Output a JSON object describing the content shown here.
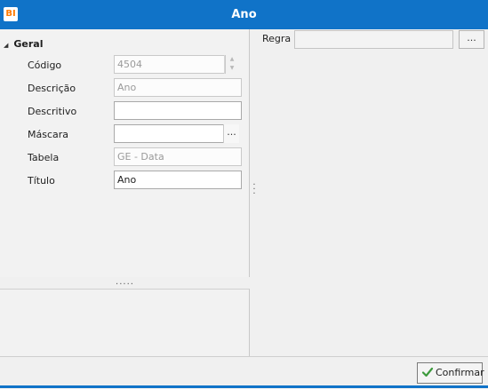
{
  "window": {
    "title": "Ano",
    "app_icon_text": "BI"
  },
  "properties": {
    "group": "Geral",
    "rows": [
      {
        "label": "Código",
        "value": "4504",
        "enabled": false
      },
      {
        "label": "Descrição",
        "value": "Ano",
        "enabled": false
      },
      {
        "label": "Descritivo",
        "value": "",
        "enabled": true
      },
      {
        "label": "Máscara",
        "value": "",
        "enabled": true
      },
      {
        "label": "Tabela",
        "value": "GE - Data",
        "enabled": false
      },
      {
        "label": "Título",
        "value": "Ano",
        "enabled": true
      }
    ]
  },
  "regra": {
    "label": "Regra",
    "value": "",
    "button_label": "..."
  },
  "mascara_button": "...",
  "splitter_grip": ".....",
  "footer": {
    "confirm_label": "Confirmar"
  }
}
